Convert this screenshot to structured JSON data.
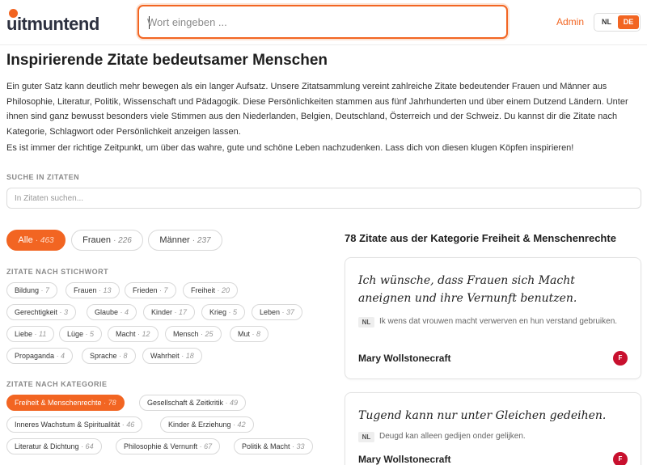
{
  "header": {
    "logo_text": "uitmuntend",
    "search_placeholder": "Wort eingeben ...",
    "admin_label": "Admin",
    "lang_nl": "NL",
    "lang_de": "DE",
    "accent_color": "#f26522"
  },
  "intro": {
    "title": "Inspirierende Zitate bedeutsamer Menschen",
    "paragraph1": "Ein guter Satz kann deutlich mehr bewegen als ein langer Aufsatz. Unsere Zitatsammlung vereint zahlreiche Zitate bedeutender Frauen und Männer aus Philosophie, Literatur, Politik, Wissenschaft und Pädagogik. Diese Persönlichkeiten stammen aus fünf Jahrhunderten und über einem Dutzend Ländern. Unter ihnen sind ganz bewusst besonders viele Stimmen aus den Niederlanden, Belgien, Deutschland, Österreich und der Schweiz. Du kannst dir die Zitate nach Kategorie, Schlagwort oder Persönlichkeit anzeigen lassen.",
    "paragraph2": "Es ist immer der richtige Zeitpunkt, um über das wahre, gute und schöne Leben nachzudenken. Lass dich von diesen klugen Köpfen inspirieren!"
  },
  "quote_search": {
    "label": "SUCHE IN ZITATEN",
    "placeholder": "In Zitaten suchen..."
  },
  "gender_filter": [
    {
      "label": "Alle",
      "count": "· 463",
      "active": true
    },
    {
      "label": "Frauen",
      "count": "· 226",
      "active": false
    },
    {
      "label": "Männer",
      "count": "· 237",
      "active": false
    }
  ],
  "keywords": {
    "label": "ZITATE NACH STICHWORT",
    "items": [
      {
        "label": "Bildung",
        "count": "· 7"
      },
      {
        "label": "Frauen",
        "count": "· 13"
      },
      {
        "label": "Frieden",
        "count": "· 7"
      },
      {
        "label": "Freiheit",
        "count": "· 20"
      },
      {
        "label": "Gerechtigkeit",
        "count": "· 3"
      },
      {
        "label": "Glaube",
        "count": "· 4"
      },
      {
        "label": "Kinder",
        "count": "· 17"
      },
      {
        "label": "Krieg",
        "count": "· 5"
      },
      {
        "label": "Leben",
        "count": "· 37"
      },
      {
        "label": "Liebe",
        "count": "· 11"
      },
      {
        "label": "Lüge",
        "count": "· 5"
      },
      {
        "label": "Macht",
        "count": "· 12"
      },
      {
        "label": "Mensch",
        "count": "· 25"
      },
      {
        "label": "Mut",
        "count": "· 8"
      },
      {
        "label": "Propaganda",
        "count": "· 4"
      },
      {
        "label": "Sprache",
        "count": "· 8"
      },
      {
        "label": "Wahrheit",
        "count": "· 18"
      }
    ]
  },
  "categories": {
    "label": "ZITATE NACH KATEGORIE",
    "items": [
      {
        "label": "Freiheit & Menschenrechte",
        "count": "· 78",
        "active": true
      },
      {
        "label": "Gesellschaft & Zeitkritik",
        "count": "· 49",
        "active": false
      },
      {
        "label": "Inneres Wachstum & Spiritualität",
        "count": "· 46",
        "active": false
      },
      {
        "label": "Kinder & Erziehung",
        "count": "· 42",
        "active": false
      },
      {
        "label": "Literatur & Dichtung",
        "count": "· 64",
        "active": false
      },
      {
        "label": "Philosophie & Vernunft",
        "count": "· 67",
        "active": false
      },
      {
        "label": "Politik & Macht",
        "count": "· 33",
        "active": false
      }
    ]
  },
  "results": {
    "title": "78 Zitate aus der Kategorie Freiheit & Menschenrechte",
    "cards": [
      {
        "quote": "Ich wünsche, dass Frauen sich Macht aneignen und ihre Vernunft benutzen.",
        "lang": "NL",
        "translation": "Ik wens dat vrouwen macht verwerven en hun verstand gebruiken.",
        "author": "Mary Wollstonecraft",
        "gender": "F"
      },
      {
        "quote": "Tugend kann nur unter Gleichen gedeihen.",
        "lang": "NL",
        "translation": "Deugd kan alleen gedijen onder gelijken.",
        "author": "Mary Wollstonecraft",
        "gender": "F"
      }
    ]
  }
}
